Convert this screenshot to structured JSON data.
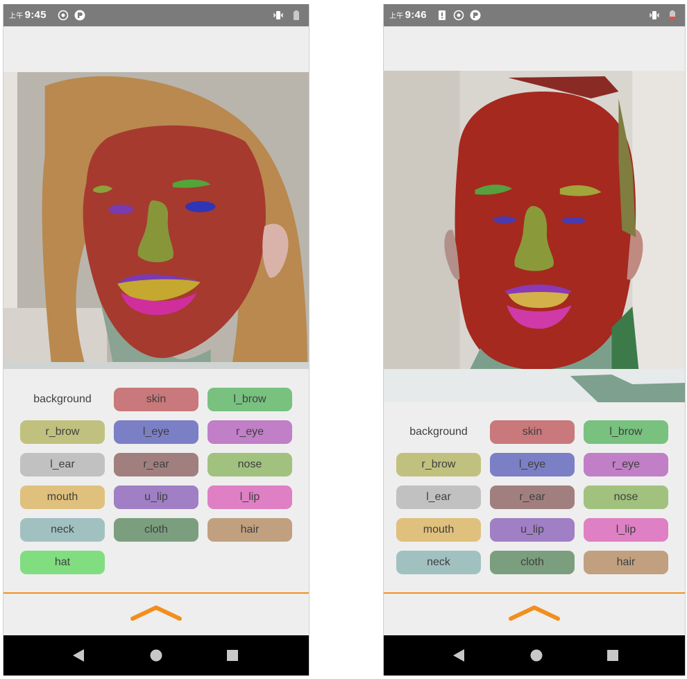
{
  "screens": [
    {
      "status_time": "9:45",
      "status_ampm": "上午",
      "labels": [
        {
          "text": "background",
          "color": "transparent"
        },
        {
          "text": "skin",
          "color": "#c9787b"
        },
        {
          "text": "l_brow",
          "color": "#78c17f"
        },
        {
          "text": "r_brow",
          "color": "#c0c17e"
        },
        {
          "text": "l_eye",
          "color": "#7b7fc5"
        },
        {
          "text": "r_eye",
          "color": "#c07fc6"
        },
        {
          "text": "l_ear",
          "color": "#c1c1c1"
        },
        {
          "text": "r_ear",
          "color": "#a27f7f"
        },
        {
          "text": "nose",
          "color": "#a1c17e"
        },
        {
          "text": "mouth",
          "color": "#e0c07d"
        },
        {
          "text": "u_lip",
          "color": "#a07fc5"
        },
        {
          "text": "l_lip",
          "color": "#df80c5"
        },
        {
          "text": "neck",
          "color": "#a1c1c1"
        },
        {
          "text": "cloth",
          "color": "#7b9f7e"
        },
        {
          "text": "hair",
          "color": "#c1a07f"
        },
        {
          "text": "hat",
          "color": "#80de80"
        }
      ]
    },
    {
      "status_time": "9:46",
      "status_ampm": "上午",
      "labels": [
        {
          "text": "background",
          "color": "transparent"
        },
        {
          "text": "skin",
          "color": "#c9787b"
        },
        {
          "text": "l_brow",
          "color": "#78c17f"
        },
        {
          "text": "r_brow",
          "color": "#c0c17e"
        },
        {
          "text": "l_eye",
          "color": "#7b7fc5"
        },
        {
          "text": "r_eye",
          "color": "#c07fc6"
        },
        {
          "text": "l_ear",
          "color": "#c1c1c1"
        },
        {
          "text": "r_ear",
          "color": "#a27f7f"
        },
        {
          "text": "nose",
          "color": "#a1c17e"
        },
        {
          "text": "mouth",
          "color": "#e0c07d"
        },
        {
          "text": "u_lip",
          "color": "#a07fc5"
        },
        {
          "text": "l_lip",
          "color": "#df80c5"
        },
        {
          "text": "neck",
          "color": "#a1c1c1"
        },
        {
          "text": "cloth",
          "color": "#7b9f7e"
        },
        {
          "text": "hair",
          "color": "#c1a07f"
        }
      ]
    }
  ],
  "theme": {
    "status_bar": "#7b7b7b",
    "divider": "#f18f1d",
    "chevron": "#f18f1d",
    "nav_bar": "#000000"
  },
  "icons": {
    "status_left": [
      "location-icon",
      "app-notification-icon"
    ],
    "status_right": [
      "vibrate-icon",
      "battery-icon"
    ],
    "nav": [
      "back-icon",
      "home-icon",
      "recents-icon"
    ],
    "expand": "chevron-up-icon"
  }
}
